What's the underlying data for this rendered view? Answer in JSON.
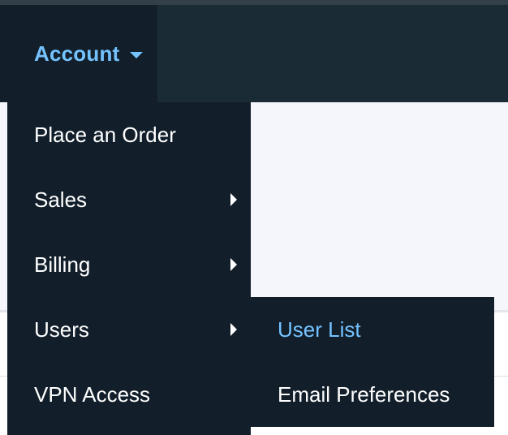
{
  "header": {
    "account_label": "Account"
  },
  "menu": {
    "items": [
      {
        "label": "Place an Order",
        "has_submenu": false
      },
      {
        "label": "Sales",
        "has_submenu": true
      },
      {
        "label": "Billing",
        "has_submenu": true
      },
      {
        "label": "Users",
        "has_submenu": true
      },
      {
        "label": "VPN Access",
        "has_submenu": false
      }
    ]
  },
  "submenu": {
    "items": [
      {
        "label": "User List",
        "active": true
      },
      {
        "label": "Email Preferences",
        "active": false
      }
    ]
  },
  "icons": {
    "account_caret": "chevron-down-icon",
    "submenu_caret": "chevron-right-icon"
  },
  "colors": {
    "menu_bg": "#121f2b",
    "header_bg": "#1b2b36",
    "accent": "#74c3ff",
    "text": "#ffffff",
    "content_bg": "#f4f6fb"
  }
}
